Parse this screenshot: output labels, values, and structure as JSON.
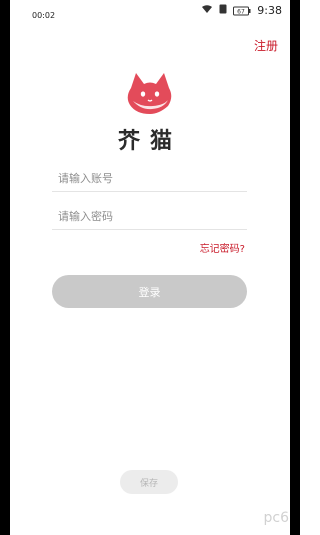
{
  "status_bar": {
    "left_time": "00:02",
    "right_time": "9:38",
    "battery_label": "67"
  },
  "header": {
    "register_label": "注册"
  },
  "app": {
    "name": "芥猫"
  },
  "login_form": {
    "account_placeholder": "请输入账号",
    "password_placeholder": "请输入密码",
    "forgot_password_label": "忘记密码?",
    "login_label": "登录"
  },
  "footer": {
    "save_label": "保存"
  },
  "watermark": {
    "text": "pc6"
  },
  "colors": {
    "accent": "#c91b2a",
    "logo_red": "#e34b5a",
    "button_gray": "#c9c9c9"
  },
  "icons": {
    "logo": "cat-head-icon",
    "wifi": "wifi-icon",
    "sim": "sim-icon",
    "battery": "battery-icon"
  }
}
